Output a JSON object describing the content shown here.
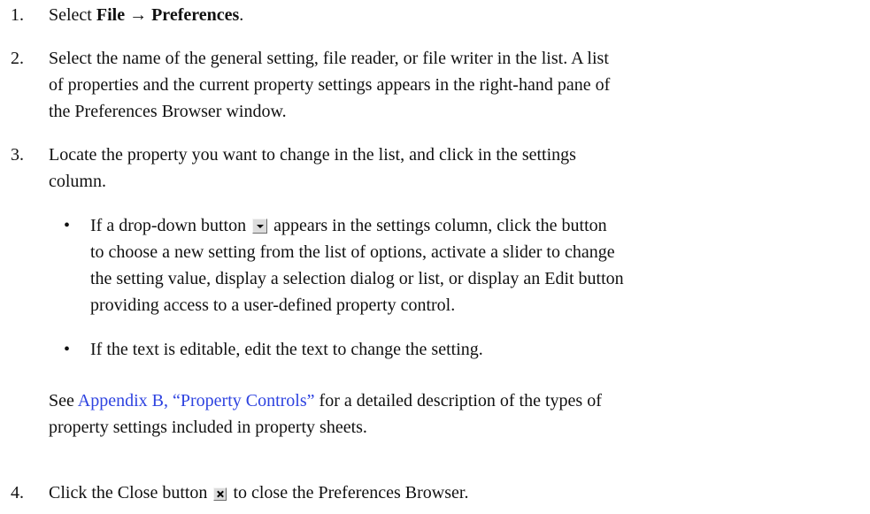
{
  "steps": [
    {
      "number": "1.",
      "prefix": "Select ",
      "menu_file": "File",
      "arrow": " → ",
      "menu_prefs": "Preferences",
      "suffix": "."
    },
    {
      "number": "2.",
      "lines": [
        "Select the name of the general setting, file reader, or file writer in the list. A list",
        "of properties and the current property settings appears in the right-hand pane of",
        "the Preferences Browser window."
      ]
    },
    {
      "number": "3.",
      "lines": [
        "Locate the property you want to change in the list, and click in the settings",
        "column."
      ],
      "bullets": [
        {
          "dot": "•",
          "line1_before": "If a drop-down button ",
          "line1_after": " appears in the settings column, click the button",
          "lines": [
            "to choose a new setting from the list of options, activate a slider to change",
            "the setting value, display a selection dialog or list, or display an Edit button",
            "providing access to a user-defined property control."
          ]
        },
        {
          "dot": "•",
          "text": "If the text is editable, edit the text to change the setting."
        }
      ],
      "see_prefix": "See ",
      "see_link": "Appendix B, “Property Controls”",
      "see_suffix": " for a detailed description of the types of",
      "see_line2": "property settings included in property sheets."
    },
    {
      "number": "4.",
      "before": "Click the Close button ",
      "after": " to close the Preferences Browser."
    }
  ],
  "icons": {
    "dropdown": "dropdown-arrow-button",
    "close": "close-x-button"
  },
  "colors": {
    "link": "#2e43e0",
    "text": "#111111"
  }
}
